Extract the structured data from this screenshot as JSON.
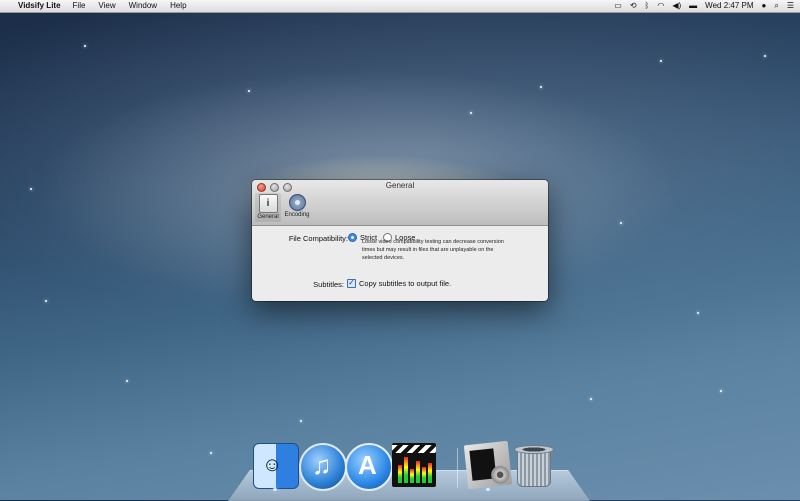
{
  "menubar": {
    "app_name": "Vidsify Lite",
    "menus": [
      "File",
      "View",
      "Window",
      "Help"
    ],
    "clock": "Wed 2:47 PM"
  },
  "window": {
    "title": "General",
    "toolbar": [
      {
        "label": "General",
        "icon": "general-icon",
        "selected": true
      },
      {
        "label": "Encoding",
        "icon": "gear-icon",
        "selected": false
      }
    ],
    "file_compatibility": {
      "label": "File Compatibility:",
      "options": [
        "Strict",
        "Loose"
      ],
      "selected": "Strict",
      "hint": "Loose video compatibility testing can decrease conversion times but may result in files that are unplayable on the selected devices."
    },
    "subtitles": {
      "label": "Subtitles:",
      "checkbox_label": "Copy subtitles to output file.",
      "checked": true
    }
  },
  "dock": {
    "items": [
      "Finder",
      "iTunes",
      "App Store",
      "Video app",
      "Vidsify Lite",
      "Trash"
    ]
  },
  "colors": {
    "accent": "#3b8ce8",
    "menubar": "#e8e8e8"
  }
}
